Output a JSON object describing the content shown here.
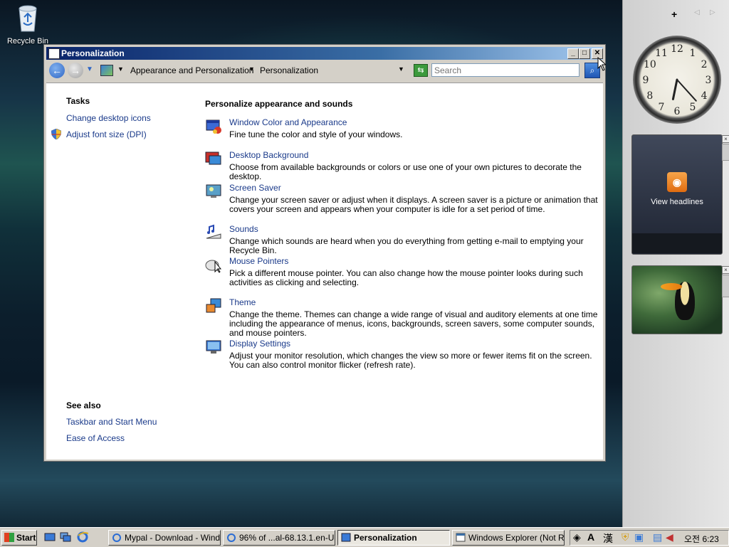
{
  "desktop": {
    "recycle_bin_label": "Recycle Bin"
  },
  "window": {
    "title": "Personalization",
    "caption_buttons": {
      "minimize": "_",
      "maximize": "□",
      "close": "✕"
    }
  },
  "navbar": {
    "address_segments": [
      "Appearance and Personalization",
      "Personalization"
    ],
    "search_placeholder": "Search"
  },
  "tasks": {
    "heading": "Tasks",
    "links": [
      "Change desktop icons",
      "Adjust font size (DPI)"
    ]
  },
  "see_also": {
    "heading": "See also",
    "links": [
      "Taskbar and Start Menu",
      "Ease of Access"
    ]
  },
  "main": {
    "heading": "Personalize appearance and sounds",
    "items": [
      {
        "title": "Window Color and Appearance",
        "desc": "Fine tune the color and style of your windows.",
        "icon": "window-color-icon"
      },
      {
        "title": "Desktop Background",
        "desc": "Choose from available backgrounds or colors or use one of your own pictures to decorate the desktop.",
        "icon": "desktop-background-icon"
      },
      {
        "title": "Screen Saver",
        "desc": "Change your screen saver or adjust when it displays. A screen saver is a picture or animation that covers your screen and appears when your computer is idle for a set period of time.",
        "icon": "screen-saver-icon"
      },
      {
        "title": "Sounds",
        "desc": "Change which sounds are heard when you do everything from getting e-mail to emptying your Recycle Bin.",
        "icon": "sounds-icon"
      },
      {
        "title": "Mouse Pointers",
        "desc": "Pick a different mouse pointer. You can also change how the mouse pointer looks during such activities as clicking and selecting.",
        "icon": "mouse-pointer-icon"
      },
      {
        "title": "Theme",
        "desc": "Change the theme. Themes can change a wide range of visual and auditory elements at one time including the appearance of menus, icons, backgrounds, screen savers, some computer sounds, and mouse pointers.",
        "icon": "theme-icon"
      },
      {
        "title": "Display Settings",
        "desc": "Adjust your monitor resolution, which changes the view so more or fewer items fit on the screen. You can also control monitor flicker (refresh rate).",
        "icon": "display-settings-icon"
      }
    ]
  },
  "sidebar": {
    "add_label": "+",
    "prev_label": "◁",
    "next_label": "▷",
    "feed_text": "View headlines",
    "clock_numbers": [
      "12",
      "1",
      "2",
      "3",
      "4",
      "5",
      "6",
      "7",
      "8",
      "9",
      "10",
      "11"
    ],
    "clock_time": {
      "hour": 6,
      "minute": 23
    }
  },
  "taskbar": {
    "start_label": "Start",
    "tasks": [
      {
        "label": "Mypal - Download - Wind...",
        "active": false
      },
      {
        "label": "96% of ...al-68.13.1.en-U...",
        "active": false
      },
      {
        "label": "Personalization",
        "active": true
      },
      {
        "label": "Windows Explorer (Not R...",
        "active": false
      }
    ],
    "tray": {
      "ime_a": "A",
      "ime_han": "漢",
      "ampm": "오전",
      "time": "6:23"
    }
  }
}
